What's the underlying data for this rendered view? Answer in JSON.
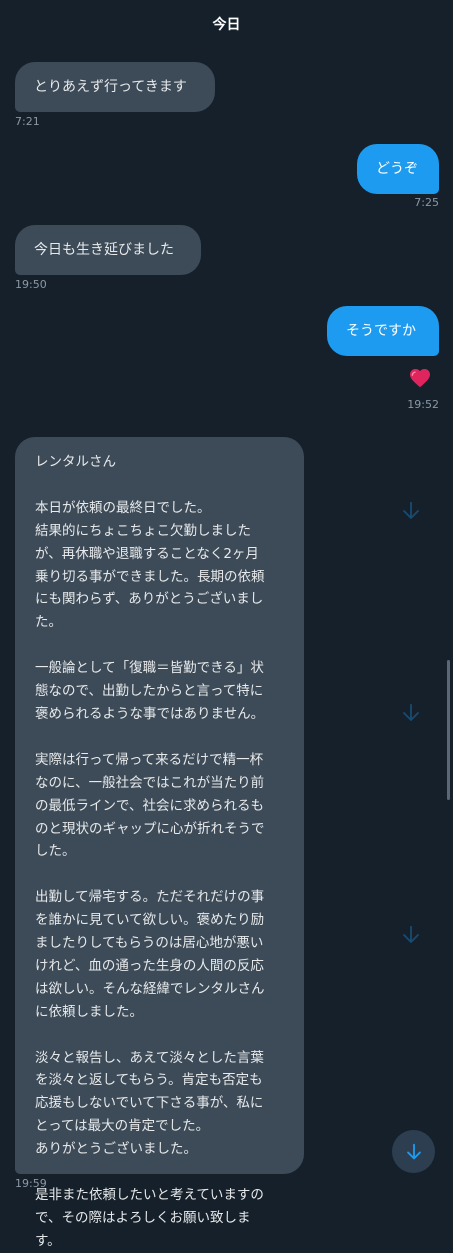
{
  "header": {
    "date": "今日"
  },
  "messages": [
    {
      "side": "incoming",
      "text": "とりあえず行ってきます",
      "time": "7:21"
    },
    {
      "side": "outgoing",
      "text": "どうぞ",
      "time": "7:25"
    },
    {
      "side": "incoming",
      "text": "今日も生き延びました",
      "time": "19:50"
    },
    {
      "side": "outgoing",
      "text": "そうですか",
      "reaction": "heart",
      "time": "19:52"
    },
    {
      "side": "incoming",
      "text": "レンタルさん\n\n本日が依頼の最終日でした。\n結果的にちょこちょこ欠勤しました\nが、再休職や退職することなく2ヶ月\n乗り切る事ができました。長期の依頼\nにも関わらず、ありがとうございまし\nた。\n\n一般論として「復職＝皆勤できる」状\n態なので、出勤したからと言って特に\n褒められるような事ではありません。\n\n実際は行って帰って来るだけで精一杯\nなのに、一般社会ではこれが当たり前\nの最低ラインで、社会に求められるも\nのと現状のギャップに心が折れそうで\nした。\n\n出勤して帰宅する。ただそれだけの事\nを誰かに見ていて欲しい。褒めたり励\nましたりしてもらうのは居心地が悪い\nけれど、血の通った生身の人間の反応\nは欲しい。そんな経緯でレンタルさん\nに依頼しました。\n\n淡々と報告し、あえて淡々とした言葉\nを淡々と返してもらう。肯定も否定も\n応援もしないでいて下さる事が、私に\nとっては最大の肯定でした。\nありがとうございました。\n\n是非また依頼したいと考えていますの\nで、その際はよろしくお願い致しま\nす。",
      "time": "19:59"
    }
  ],
  "colors": {
    "background": "#15202b",
    "incoming_bubble": "#3d4b59",
    "outgoing_bubble": "#1d9bf0",
    "timestamp": "#8b98a5",
    "accent": "#1d9bf0"
  },
  "icons": {
    "reaction": "heart-icon",
    "scroll_down": "arrow-down-icon"
  }
}
